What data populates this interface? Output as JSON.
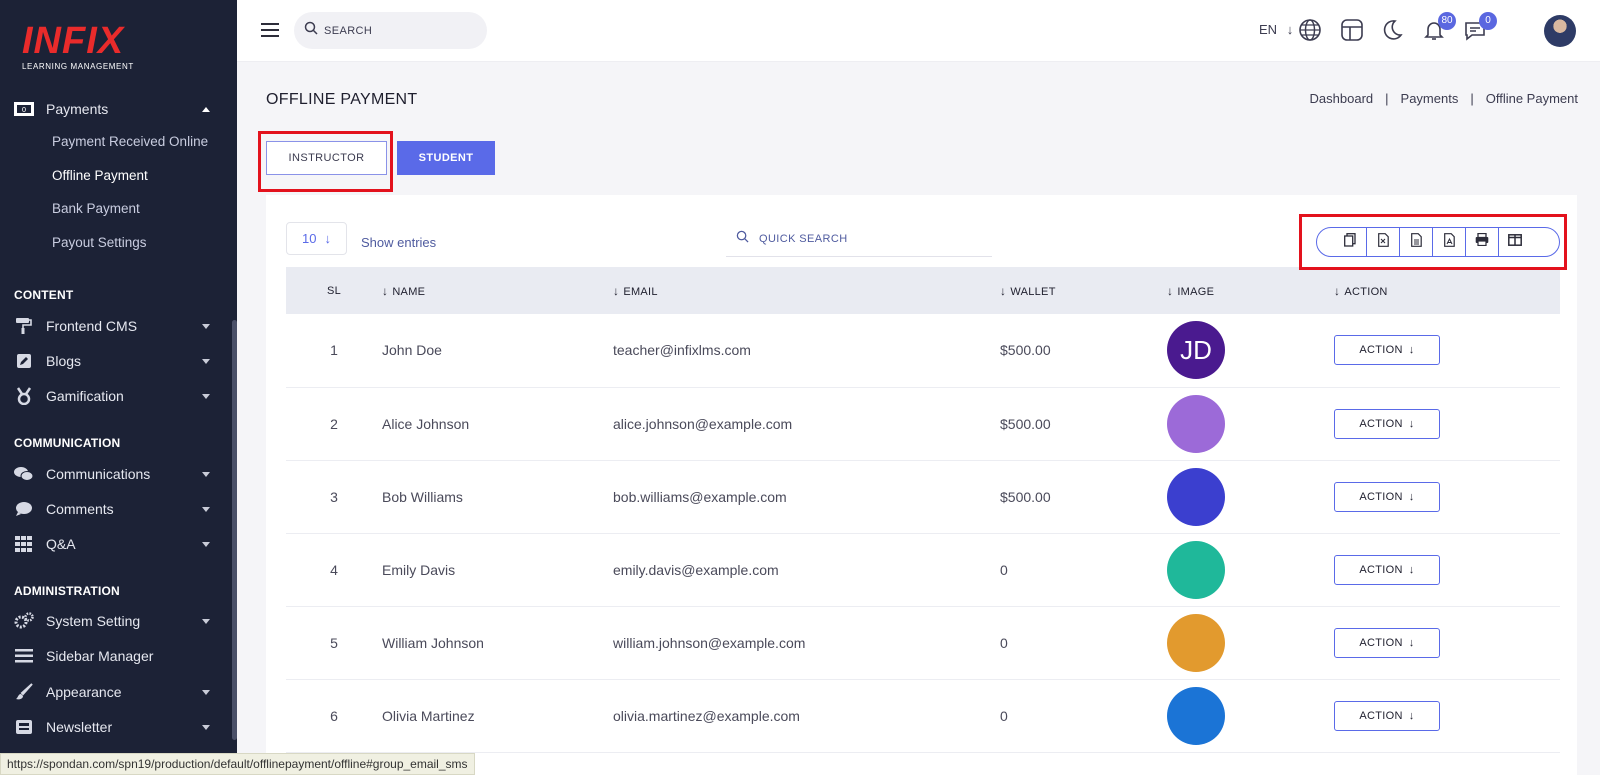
{
  "brand": {
    "name": "INFIX",
    "tagline": "LEARNING MANAGEMENT",
    "color": "#ea2b2b"
  },
  "sidebar": {
    "payments": {
      "label": "Payments",
      "icon": "money-icon",
      "items": [
        {
          "label": "Payment Received Online"
        },
        {
          "label": "Offline Payment"
        },
        {
          "label": "Bank Payment"
        },
        {
          "label": "Payout Settings"
        }
      ]
    },
    "sections": [
      {
        "title": "CONTENT",
        "items": [
          {
            "label": "Frontend CMS",
            "icon": "paint-roller-icon"
          },
          {
            "label": "Blogs",
            "icon": "edit-icon"
          },
          {
            "label": "Gamification",
            "icon": "medal-icon"
          }
        ]
      },
      {
        "title": "COMMUNICATION",
        "items": [
          {
            "label": "Communications",
            "icon": "chat-icon"
          },
          {
            "label": "Comments",
            "icon": "comment-icon"
          },
          {
            "label": "Q&A",
            "icon": "grid-icon"
          }
        ]
      },
      {
        "title": "ADMINISTRATION",
        "items": [
          {
            "label": "System Setting",
            "icon": "gears-icon"
          },
          {
            "label": "Sidebar Manager",
            "icon": "bars-icon"
          },
          {
            "label": "Appearance",
            "icon": "brush-icon"
          },
          {
            "label": "Newsletter",
            "icon": "newsletter-icon"
          }
        ]
      }
    ]
  },
  "header": {
    "search_placeholder": "SEARCH",
    "language": "EN",
    "notifications_count": "80",
    "messages_count": "0",
    "accent": "#5a6ae8"
  },
  "page": {
    "title": "OFFLINE PAYMENT",
    "breadcrumb": [
      "Dashboard",
      "Payments",
      "Offline Payment"
    ],
    "tabs": {
      "instructor": "INSTRUCTOR",
      "student": "STUDENT"
    }
  },
  "table_controls": {
    "entries_value": "10",
    "show_entries": "Show entries",
    "quick_search_placeholder": "QUICK SEARCH",
    "export_buttons": [
      "copy-icon",
      "excel-icon",
      "csv-icon",
      "pdf-icon",
      "print-icon",
      "columns-icon"
    ]
  },
  "table": {
    "headers": {
      "sl": "SL",
      "name": "NAME",
      "email": "EMAIL",
      "wallet": "WALLET",
      "image": "IMAGE",
      "action": "ACTION"
    },
    "action_label": "ACTION",
    "rows": [
      {
        "sl": "1",
        "name": "John Doe",
        "email": "teacher@infixlms.com",
        "wallet": "$500.00",
        "initials": "JD",
        "avatar_color": "#4a1a8f"
      },
      {
        "sl": "2",
        "name": "Alice Johnson",
        "email": "alice.johnson@example.com",
        "wallet": "$500.00",
        "initials": "",
        "avatar_color": "#9c6ad8"
      },
      {
        "sl": "3",
        "name": "Bob Williams",
        "email": "bob.williams@example.com",
        "wallet": "$500.00",
        "initials": "",
        "avatar_color": "#3b3fcf"
      },
      {
        "sl": "4",
        "name": "Emily Davis",
        "email": "emily.davis@example.com",
        "wallet": "0",
        "initials": "",
        "avatar_color": "#1fb89a"
      },
      {
        "sl": "5",
        "name": "William Johnson",
        "email": "william.johnson@example.com",
        "wallet": "0",
        "initials": "",
        "avatar_color": "#e29a2e"
      },
      {
        "sl": "6",
        "name": "Olivia Martinez",
        "email": "olivia.martinez@example.com",
        "wallet": "0",
        "initials": "",
        "avatar_color": "#1b74d6"
      }
    ]
  },
  "status_url": "https://spondan.com/spn19/production/default/offlinepayment/offline#group_email_sms"
}
